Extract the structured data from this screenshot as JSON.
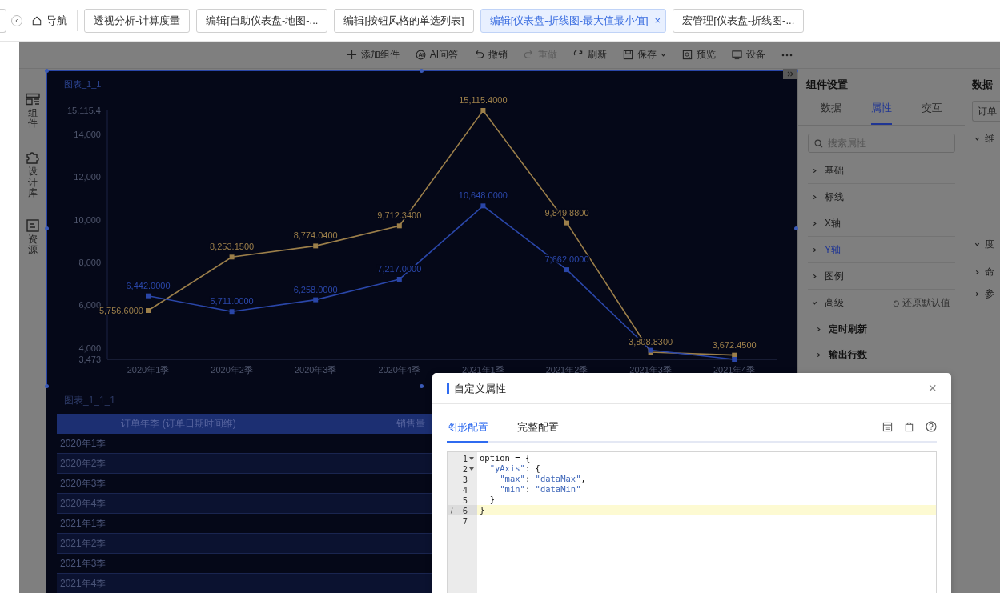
{
  "top_bar": {
    "nav_label": "导航",
    "tabs": [
      {
        "label": "透视分析-计算度量",
        "selected": false,
        "closable": false
      },
      {
        "label": "编辑[自助仪表盘-地图-...",
        "selected": false,
        "closable": false
      },
      {
        "label": "编辑[按钮风格的单选列表]",
        "selected": false,
        "closable": false
      },
      {
        "label": "编辑[仪表盘-折线图-最大值最小值]",
        "selected": true,
        "closable": true,
        "close_glyph": "×"
      },
      {
        "label": "宏管理[仪表盘-折线图-...",
        "selected": false,
        "closable": false
      }
    ]
  },
  "toolbar": [
    {
      "label": "添加组件",
      "kind": "plus",
      "disabled": false,
      "dropdown": false
    },
    {
      "label": "AI问答",
      "kind": "ai",
      "disabled": false,
      "dropdown": false
    },
    {
      "label": "撤销",
      "kind": "undo",
      "disabled": false,
      "dropdown": false
    },
    {
      "label": "重做",
      "kind": "redo",
      "disabled": true,
      "dropdown": false
    },
    {
      "label": "刷新",
      "kind": "refresh",
      "disabled": false,
      "dropdown": false
    },
    {
      "label": "保存",
      "kind": "save",
      "disabled": false,
      "dropdown": true
    },
    {
      "label": "预览",
      "kind": "preview",
      "disabled": false,
      "dropdown": false
    },
    {
      "label": "设备",
      "kind": "device",
      "disabled": false,
      "dropdown": false
    }
  ],
  "left_sidebar": [
    {
      "label": "组件",
      "kind": "components"
    },
    {
      "label": "设计库",
      "kind": "puzzle"
    },
    {
      "label": "资源",
      "kind": "resource"
    }
  ],
  "chart_widget": {
    "title": "图表_1_1",
    "chart_data": {
      "type": "line",
      "categories": [
        "2020年1季",
        "2020年2季",
        "2020年3季",
        "2020年4季",
        "2021年1季",
        "2021年2季",
        "2021年3季",
        "2021年4季"
      ],
      "series": [
        {
          "color": "#9c7f4a",
          "marker": "square",
          "values": [
            5756.6,
            8253.15,
            8774.04,
            9712.34,
            15115.4,
            9849.88,
            3808.83,
            3672.45
          ],
          "value_labels": [
            "5,756.6000",
            "8,253.1500",
            "8,774.0400",
            "9,712.3400",
            "15,115.4000",
            "9,849.8800",
            "3,808.8300",
            "3,672.4500"
          ]
        },
        {
          "color": "#2a46a8",
          "marker": "square",
          "values": [
            6442,
            5711,
            6258,
            7217,
            10648,
            7662,
            3900,
            3473
          ],
          "value_labels": [
            "6,442.0000",
            "5,711.0000",
            "6,258.0000",
            "7,217.0000",
            "10,648.0000",
            "7,662.0000",
            null,
            null
          ]
        }
      ],
      "ylim": [
        3473,
        15115.4
      ],
      "yticks": [
        {
          "value": 3473,
          "label": "3,473"
        },
        {
          "value": 4000,
          "label": "4,000"
        },
        {
          "value": 6000,
          "label": "6,000"
        },
        {
          "value": 8000,
          "label": "8,000"
        },
        {
          "value": 10000,
          "label": "10,000"
        },
        {
          "value": 12000,
          "label": "12,000"
        },
        {
          "value": 14000,
          "label": "14,000"
        },
        {
          "value": 15115.4,
          "label": "15,115.4"
        }
      ]
    }
  },
  "table_widget": {
    "title": "图表_1_1_1",
    "columns": [
      "订单年季 (订单日期时间维)",
      "销售量"
    ],
    "rows": [
      "2020年1季",
      "2020年2季",
      "2020年3季",
      "2020年4季",
      "2021年1季",
      "2021年2季",
      "2021年3季",
      "2021年4季"
    ]
  },
  "settings_panel": {
    "title": "组件设置",
    "tabs": [
      {
        "label": "数据",
        "selected": false
      },
      {
        "label": "属性",
        "selected": true
      },
      {
        "label": "交互",
        "selected": false
      }
    ],
    "search": {
      "placeholder": "搜索属性"
    },
    "sections": [
      {
        "label": "基础",
        "selected": false,
        "expanded": false
      },
      {
        "label": "标线",
        "selected": false,
        "expanded": false
      },
      {
        "label": "X轴",
        "selected": false,
        "expanded": false
      },
      {
        "label": "Y轴",
        "selected": true,
        "expanded": false
      },
      {
        "label": "图例",
        "selected": false,
        "expanded": false
      },
      {
        "label": "高级",
        "selected": false,
        "expanded": true,
        "action": "还原默认值",
        "children": [
          {
            "label": "定时刷新"
          },
          {
            "label": "输出行数"
          }
        ]
      }
    ]
  },
  "data_panel": {
    "title": "数据",
    "dataset": "订单",
    "tree": [
      {
        "label": "维",
        "expanded": true
      },
      {
        "label": "度",
        "expanded": true
      },
      {
        "label": "命",
        "expanded": false
      },
      {
        "label": "参",
        "expanded": false
      }
    ]
  },
  "modal": {
    "title": "自定义属性",
    "close_glyph": "×",
    "tabs": [
      {
        "label": "图形配置",
        "selected": true
      },
      {
        "label": "完整配置",
        "selected": false
      }
    ],
    "code_lines": [
      {
        "number": "1",
        "text": "option = {",
        "foldable": true,
        "highlighted": false,
        "info": false
      },
      {
        "number": "2",
        "text": "  \"yAxis\": {",
        "foldable": true,
        "highlighted": false,
        "info": false
      },
      {
        "number": "3",
        "text": "    \"max\": \"dataMax\",",
        "foldable": false,
        "highlighted": false,
        "info": false
      },
      {
        "number": "4",
        "text": "    \"min\": \"dataMin\"",
        "foldable": false,
        "highlighted": false,
        "info": false
      },
      {
        "number": "5",
        "text": "  }",
        "foldable": false,
        "highlighted": false,
        "info": false
      },
      {
        "number": "6",
        "text": "}",
        "foldable": false,
        "highlighted": true,
        "info": true
      },
      {
        "number": "7",
        "foldable": false,
        "highlighted": false,
        "info": false
      }
    ]
  }
}
